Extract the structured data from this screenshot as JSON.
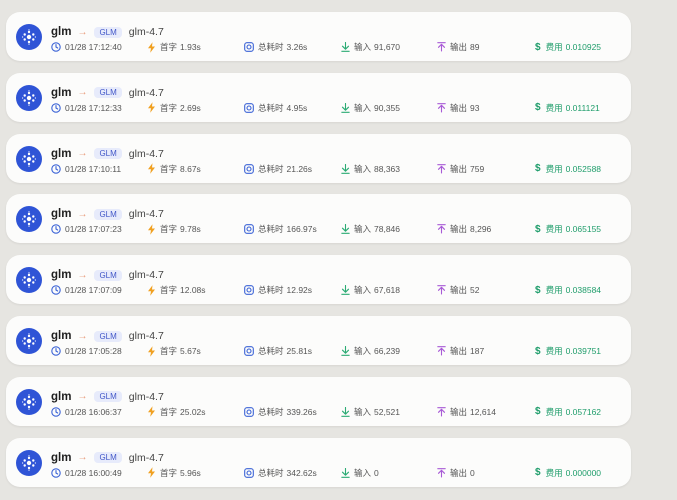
{
  "colors": {
    "background": "#e6e5e1",
    "card": "#fcfcfb",
    "avatar": "#2f54d6",
    "tag_bg": "#e7ebfb",
    "tag_text": "#4257c8",
    "clock": "#3b63d6",
    "lightning": "#f0a020",
    "timer": "#3b63d6",
    "input_arrow": "#2bab74",
    "output_arrow": "#a85ad6",
    "cost": "#1f9d6b"
  },
  "icons": {
    "avatar": "glm-logo-icon",
    "time": "clock-icon",
    "first_token": "lightning-icon",
    "total": "timer-icon",
    "input": "arrow-down-icon",
    "output": "arrow-up-icon",
    "cost": "dollar-icon"
  },
  "labels": {
    "first_token": "首字",
    "total": "总耗时",
    "input": "输入",
    "output": "输出",
    "cost": "费用",
    "arrow": "→",
    "cost_sign": "$"
  },
  "entries": [
    {
      "provider": "glm",
      "tag": "GLM",
      "model": "glm-4.7",
      "time": "01/28 17:12:40",
      "first_token": "1.93s",
      "total": "3.26s",
      "input": "91,670",
      "output": "89",
      "cost": "0.010925"
    },
    {
      "provider": "glm",
      "tag": "GLM",
      "model": "glm-4.7",
      "time": "01/28 17:12:33",
      "first_token": "2.69s",
      "total": "4.95s",
      "input": "90,355",
      "output": "93",
      "cost": "0.011121"
    },
    {
      "provider": "glm",
      "tag": "GLM",
      "model": "glm-4.7",
      "time": "01/28 17:10:11",
      "first_token": "8.67s",
      "total": "21.26s",
      "input": "88,363",
      "output": "759",
      "cost": "0.052588"
    },
    {
      "provider": "glm",
      "tag": "GLM",
      "model": "glm-4.7",
      "time": "01/28 17:07:23",
      "first_token": "9.78s",
      "total": "166.97s",
      "input": "78,846",
      "output": "8,296",
      "cost": "0.065155"
    },
    {
      "provider": "glm",
      "tag": "GLM",
      "model": "glm-4.7",
      "time": "01/28 17:07:09",
      "first_token": "12.08s",
      "total": "12.92s",
      "input": "67,618",
      "output": "52",
      "cost": "0.038584"
    },
    {
      "provider": "glm",
      "tag": "GLM",
      "model": "glm-4.7",
      "time": "01/28 17:05:28",
      "first_token": "5.67s",
      "total": "25.81s",
      "input": "66,239",
      "output": "187",
      "cost": "0.039751"
    },
    {
      "provider": "glm",
      "tag": "GLM",
      "model": "glm-4.7",
      "time": "01/28 16:06:37",
      "first_token": "25.02s",
      "total": "339.26s",
      "input": "52,521",
      "output": "12,614",
      "cost": "0.057162"
    },
    {
      "provider": "glm",
      "tag": "GLM",
      "model": "glm-4.7",
      "time": "01/28 16:00:49",
      "first_token": "5.96s",
      "total": "342.62s",
      "input": "0",
      "output": "0",
      "cost": "0.000000"
    }
  ]
}
